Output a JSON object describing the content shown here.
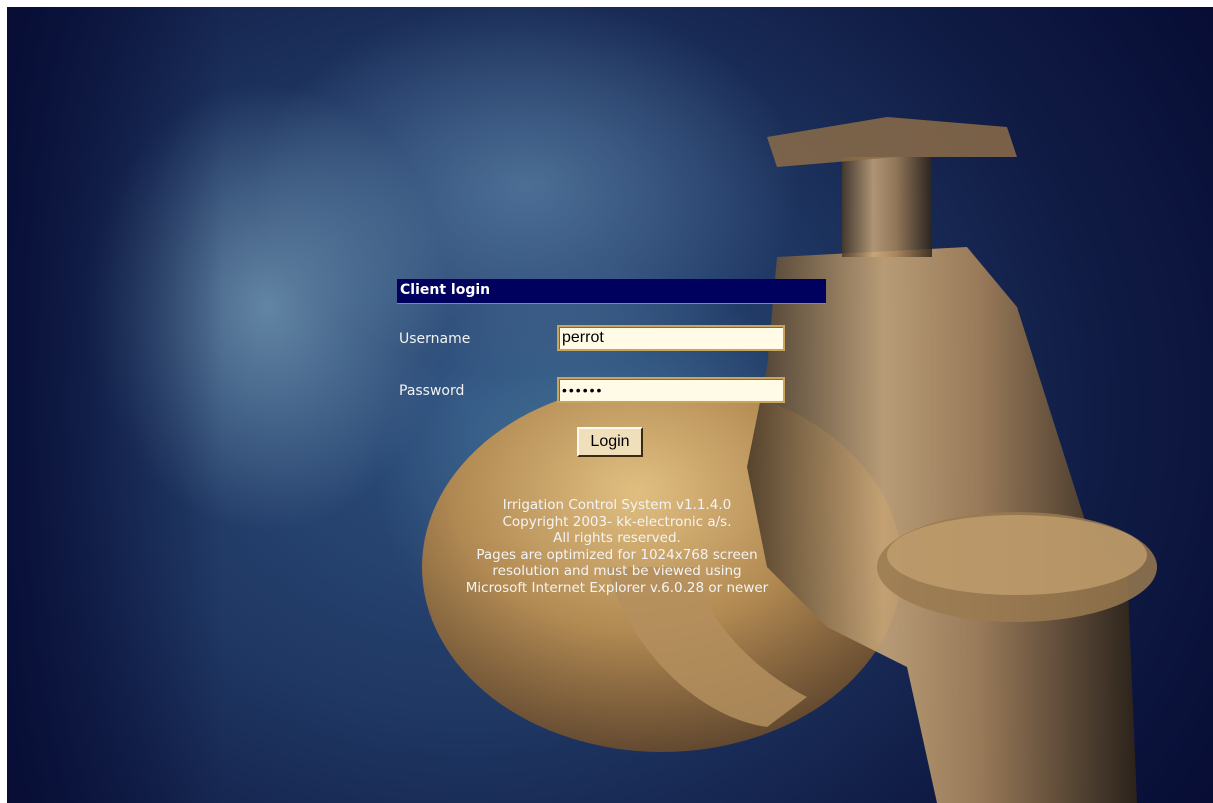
{
  "login": {
    "title": "Client login",
    "username_label": "Username",
    "username_value": "perrot",
    "password_label": "Password",
    "password_value": "••••••",
    "submit_label": "Login"
  },
  "footer": {
    "lines": [
      "Irrigation Control System v1.1.4.0",
      "Copyright 2003- kk-electronic a/s.",
      "All rights reserved.",
      "Pages are optimized for 1024x768 screen",
      "resolution and must be viewed using",
      "Microsoft Internet Explorer v.6.0.28 or newer"
    ]
  },
  "colors": {
    "header_bar": "#00005e",
    "background_dark": "#060b33",
    "field_background": "#fffbe6",
    "button_background": "#efe0bb"
  }
}
